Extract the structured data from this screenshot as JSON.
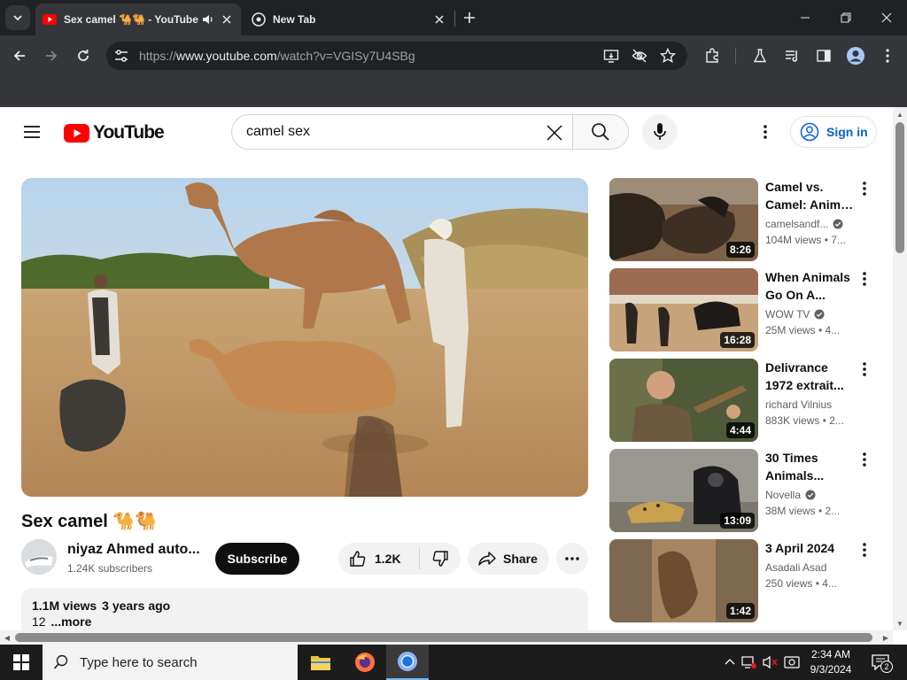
{
  "browser": {
    "tabs": [
      {
        "title": "Sex camel 🐪🐫 - YouTube",
        "favicon": "youtube-favicon",
        "audio": true,
        "active": true
      },
      {
        "title": "New Tab",
        "favicon": "chrome-favicon",
        "active": false
      }
    ],
    "url": {
      "scheme": "https://",
      "host": "www.youtube.com",
      "path": "/watch?v=VGISy7U4SBg"
    },
    "toolbar_icons": [
      "back-icon",
      "forward-icon",
      "reload-icon",
      "tune-icon",
      "install-app-icon",
      "eye-off-icon",
      "star-icon",
      "extensions-icon",
      "labs-icon",
      "media-control-icon",
      "side-panel-icon",
      "profile-icon",
      "kebab-icon"
    ]
  },
  "youtube": {
    "logo_text": "YouTube",
    "search": {
      "value": "camel sex"
    },
    "signin_label": "Sign in",
    "video": {
      "title": "Sex camel 🐪🐫",
      "channel": "niyaz Ahmed auto...",
      "subscribers": "1.24K subscribers",
      "subscribe_label": "Subscribe",
      "likes": "1.2K",
      "share_label": "Share",
      "views": "1.1M views",
      "age": "3 years ago",
      "description_text": "12",
      "more_label": "...more"
    },
    "recommendations": [
      {
        "title_line1": "Camel vs.",
        "title_line2": "Camel: Anima...",
        "channel": "camelsandf...",
        "verified": true,
        "stats": "104M views • 7...",
        "duration": "8:26"
      },
      {
        "title_line1": "When Animals",
        "title_line2": "Go On A...",
        "channel": "WOW TV",
        "verified": true,
        "stats": "25M views • 4...",
        "duration": "16:28"
      },
      {
        "title_line1": "Delivrance",
        "title_line2": "1972 extrait...",
        "channel": "richard Vilnius",
        "verified": false,
        "stats": "883K views • 2...",
        "duration": "4:44"
      },
      {
        "title_line1": "30 Times",
        "title_line2": "Animals...",
        "channel": "Novella",
        "verified": true,
        "stats": "38M views • 2...",
        "duration": "13:09"
      },
      {
        "title_line1": "3 April 2024",
        "title_line2": "",
        "channel": "Asadali Asad",
        "verified": false,
        "stats": "250 views • 4...",
        "duration": "1:42"
      }
    ]
  },
  "taskbar": {
    "search_placeholder": "Type here to search",
    "time": "2:34 AM",
    "date": "9/3/2024",
    "notification_count": "2"
  },
  "colors": {
    "youtube_red": "#ff0000",
    "link_blue": "#065fd4",
    "chrome_dark": "#35363a",
    "taskbar": "#1c1c1c"
  }
}
